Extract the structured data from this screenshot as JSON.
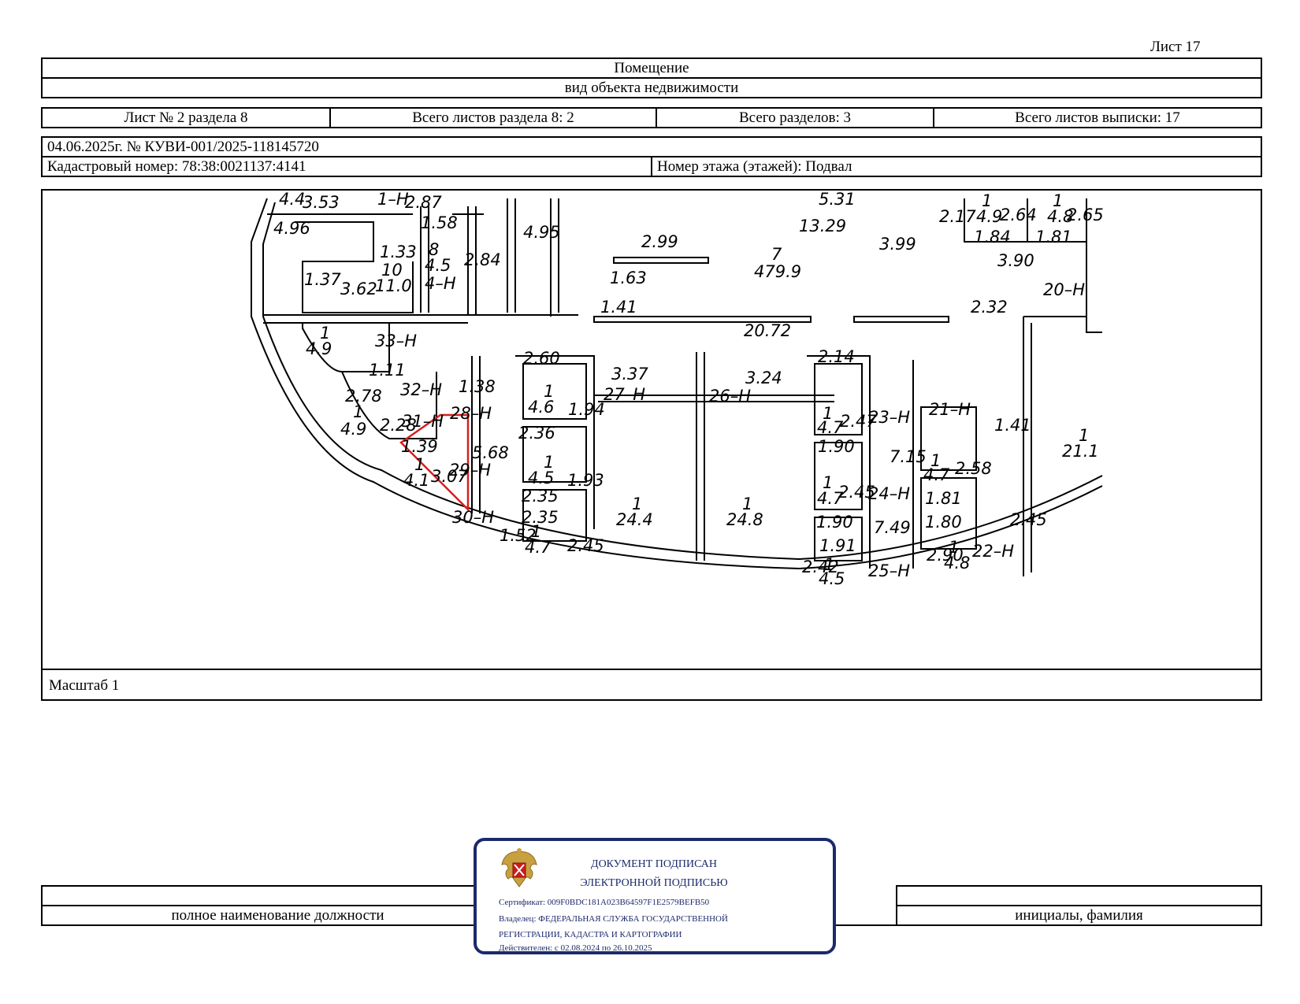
{
  "sheet_label": "Лист 17",
  "header": {
    "object": "Помещение",
    "object_kind": "вид объекта недвижимости"
  },
  "sheets_row": {
    "sheet_of_section": "Лист № 2 раздела 8",
    "total_sheets_section": "Всего листов раздела 8: 2",
    "total_sections": "Всего разделов: 3",
    "total_sheets_extract": "Всего листов выписки: 17"
  },
  "doc_info": {
    "date_number": "04.06.2025г. № КУВИ-001/2025-118145720",
    "cadastral_number": "Кадастровый номер: 78:38:0021137:4141",
    "floor": "Номер этажа (этажей): Подвал"
  },
  "plan": {
    "labels": [
      "4.4",
      "3.53",
      "1–Н",
      "2.87",
      "4.96",
      "1.58",
      "1.33",
      "8",
      "4.5",
      "2.84",
      "10",
      "11.0",
      "1.37",
      "3.62",
      "4–Н",
      "4.95",
      "2.99",
      "1.63",
      "5.31",
      "13.29",
      "7",
      "479.9",
      "3.99",
      "2.17",
      "1",
      "4.9",
      "2.64",
      "1",
      "4.8",
      "2.65",
      "1.84",
      "1.81",
      "3.90",
      "20–Н",
      "1.41",
      "20.72",
      "2.32",
      "1",
      "4.9",
      "33–Н",
      "1.11",
      "2.60",
      "3.37",
      "27–Н",
      "3.24",
      "26–Н",
      "2.14",
      "2.78",
      "32–Н",
      "1.38",
      "1",
      "4.6",
      "1.94",
      "1",
      "4.9",
      "2.28",
      "31–Н",
      "28–Н",
      "2.36",
      "1",
      "4.7",
      "2.47",
      "23–Н",
      "21–Н",
      "1.41",
      "1",
      "21.1",
      "1.39",
      "5.68",
      "1.90",
      "7.15",
      "1",
      "4.7",
      "2.58",
      "1",
      "4.1",
      "3.07",
      "29–Н",
      "1",
      "4.5",
      "1.93",
      "1",
      "4.7",
      "2.45",
      "24–Н",
      "1.81",
      "2.35",
      "1",
      "24.4",
      "1",
      "24.8",
      "1.90",
      "1.80",
      "2.45",
      "30–Н",
      "2.35",
      "1",
      "4.7",
      "2.45",
      "1.52",
      "1.91",
      "7.49",
      "22–Н",
      "2.90",
      "1",
      "4.8",
      "2.42",
      "1",
      "4.5",
      "25–Н"
    ]
  },
  "scale_label": "Масштаб 1",
  "signature": {
    "position_caption": "полное наименование должности",
    "name_caption": "инициалы, фамилия"
  },
  "stamp": {
    "line1": "ДОКУМЕНТ ПОДПИСАН",
    "line2": "ЭЛЕКТРОННОЙ ПОДПИСЬЮ",
    "certificate": "Сертификат: 009F0BDC181A023B64597F1E2579BEFB50",
    "owner1": "Владелец: ФЕДЕРАЛЬНАЯ СЛУЖБА ГОСУДАРСТВЕННОЙ",
    "owner2": "РЕГИСТРАЦИИ, КАДАСТРА И КАРТОГРАФИИ",
    "valid": "Действителен: с 02.08.2024 по 26.10.2025"
  },
  "colors": {
    "stamp": "#1b2a6b",
    "highlight": "#d42020"
  }
}
